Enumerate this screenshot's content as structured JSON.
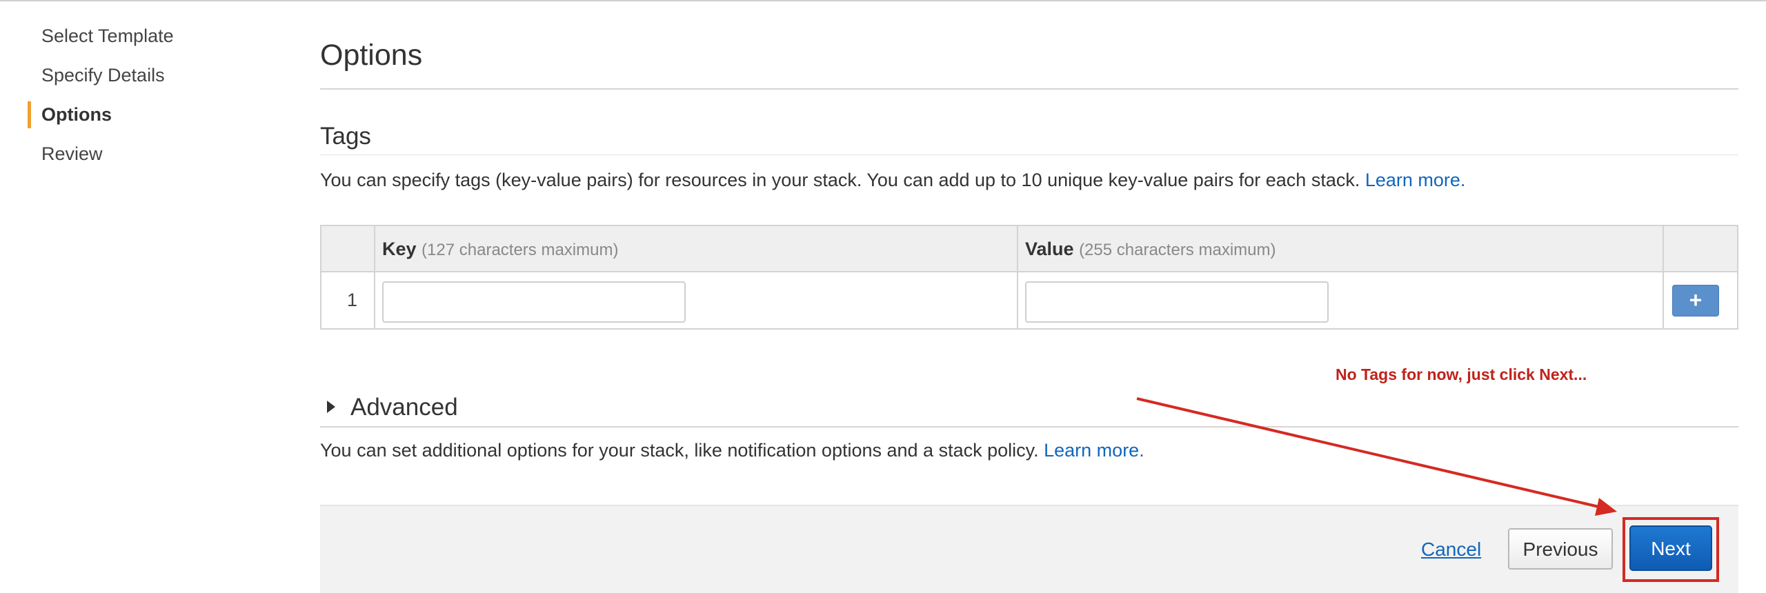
{
  "sidebar": {
    "steps": [
      {
        "label": "Select Template"
      },
      {
        "label": "Specify Details"
      },
      {
        "label": "Options"
      },
      {
        "label": "Review"
      }
    ],
    "active_index": 2,
    "accent_color": "#f0a030"
  },
  "page": {
    "title": "Options"
  },
  "tags": {
    "title": "Tags",
    "description": "You can specify tags (key-value pairs) for resources in your stack. You can add up to 10 unique key-value pairs for each stack.",
    "learn_more": "Learn more.",
    "table": {
      "key_header": "Key",
      "key_hint": "(127 characters maximum)",
      "value_header": "Value",
      "value_hint": "(255 characters maximum)",
      "rows": [
        {
          "number": "1",
          "key": "",
          "value": ""
        }
      ],
      "add_icon": "plus-icon",
      "add_label": "+"
    }
  },
  "advanced": {
    "title": "Advanced",
    "description": "You can set additional options for your stack, like notification options and a stack policy.",
    "learn_more": "Learn more."
  },
  "annotation": {
    "text": "No Tags for now, just click Next...",
    "color": "#c0221a"
  },
  "footer": {
    "cancel_label": "Cancel",
    "previous_label": "Previous",
    "next_label": "Next"
  },
  "colors": {
    "link": "#1166bb",
    "primary_button": "#1f78d1",
    "add_button": "#5a90cc",
    "highlight": "#d42a22"
  }
}
